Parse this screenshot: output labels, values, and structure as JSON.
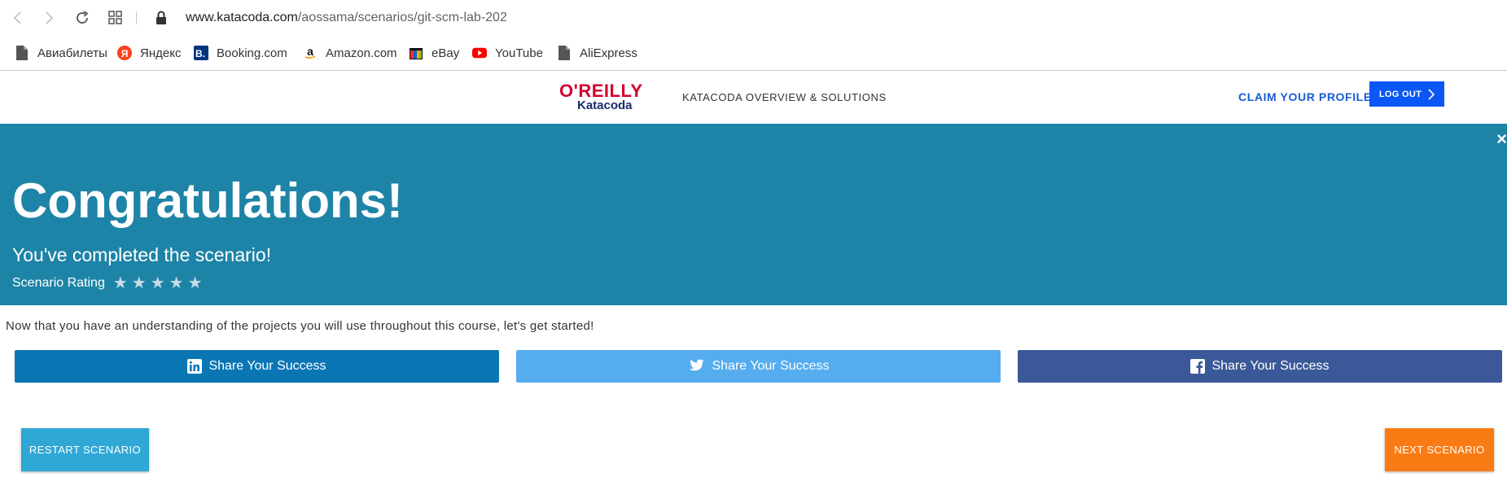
{
  "browser": {
    "address": {
      "domain": "www.katacoda.com",
      "path": "/aossama/scenarios/git-scm-lab-202"
    },
    "bookmarks": [
      {
        "label": "Авиабилеты",
        "icon": "file-icon"
      },
      {
        "label": "Яндекс",
        "icon": "yandex-icon"
      },
      {
        "label": "Booking.com",
        "icon": "booking-icon"
      },
      {
        "label": "Amazon.com",
        "icon": "amazon-icon"
      },
      {
        "label": "eBay",
        "icon": "ebay-icon"
      },
      {
        "label": "YouTube",
        "icon": "youtube-icon"
      },
      {
        "label": "AliExpress",
        "icon": "file-icon"
      }
    ]
  },
  "header": {
    "logo_top": "O'REILLY",
    "logo_bottom": "Katacoda",
    "nav_overview": "KATACODA OVERVIEW & SOLUTIONS",
    "claim_profile": "CLAIM YOUR PROFILE",
    "logout": "LOG OUT"
  },
  "banner": {
    "title": "Congratulations!",
    "subtitle": "You've completed the scenario!",
    "rating_label": "Scenario Rating",
    "close": "×",
    "star_count": 5
  },
  "main": {
    "intro": "Now that you have an understanding of the projects you will use throughout this course, let's get started!",
    "share": {
      "linkedin": "Share Your Success",
      "twitter": "Share Your Success",
      "facebook": "Share Your Success"
    },
    "restart": "RESTART SCENARIO",
    "next": "NEXT SCENARIO"
  },
  "colors": {
    "banner": "#1e84a7",
    "linkedin": "#0a76b4",
    "twitter": "#55acee",
    "facebook": "#3b5998",
    "restart": "#2fa8d6",
    "next": "#fa7b14",
    "logout": "#0b57f5"
  }
}
